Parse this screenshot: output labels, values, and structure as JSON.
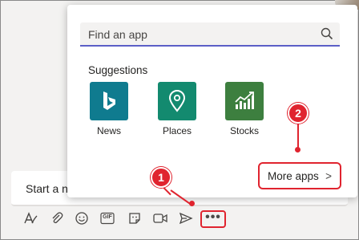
{
  "flyout": {
    "search": {
      "placeholder": "Find an app"
    },
    "suggestions_heading": "Suggestions",
    "apps": [
      {
        "label": "News",
        "icon": "bing-icon",
        "color": "#0f7b8f"
      },
      {
        "label": "Places",
        "icon": "map-pin-icon",
        "color": "#138a6f"
      },
      {
        "label": "Stocks",
        "icon": "stock-chart-icon",
        "color": "#3d7f3f"
      }
    ],
    "more_apps_label": "More apps",
    "more_apps_chevron": ">"
  },
  "compose": {
    "placeholder": "Start a n"
  },
  "toolbar": {
    "tools": [
      "format-icon",
      "attach-icon",
      "emoji-icon",
      "gif-icon",
      "sticker-icon",
      "meet-now-icon",
      "send-icon"
    ],
    "gif_label": "GIF",
    "more_label": "•••"
  },
  "callouts": {
    "first": "1",
    "second": "2",
    "color": "#e0242f"
  },
  "colors": {
    "accent": "#5b5fc7",
    "highlight": "#e0242f"
  }
}
